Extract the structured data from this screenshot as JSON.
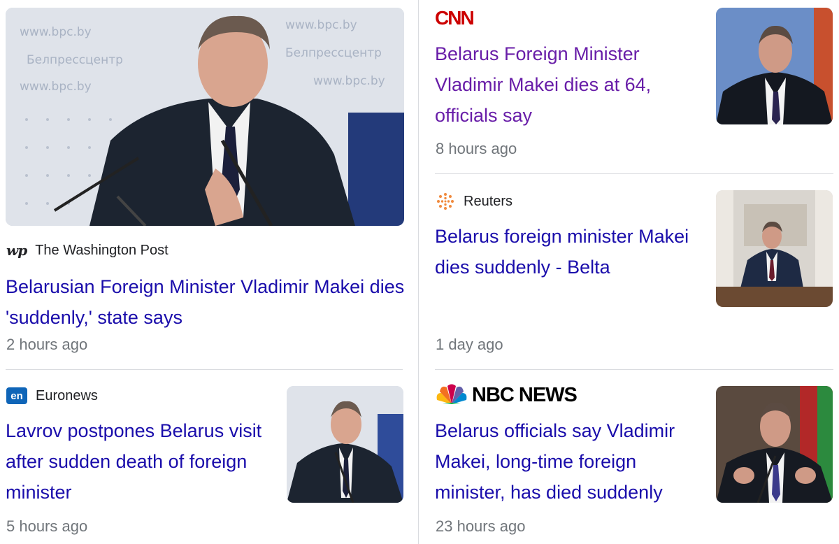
{
  "articles": [
    {
      "source": "The Washington Post",
      "source_logo": "wp",
      "headline": "Belarusian Foreign Minister Vladimir Makei dies 'suddenly,' state says",
      "time": "2 hours ago"
    },
    {
      "source": "CNN",
      "source_logo": "CNN",
      "headline": "Belarus Foreign Minister Vladimir Makei dies at 64, officials say",
      "time": "8 hours ago"
    },
    {
      "source": "Reuters",
      "source_logo": "reuters-icon",
      "headline": "Belarus foreign minister Makei dies suddenly - Belta",
      "time": "1 day ago"
    },
    {
      "source": "Euronews",
      "source_logo": "en",
      "headline": "Lavrov postpones Belarus visit after sudden death of foreign minister",
      "time": "5 hours ago"
    },
    {
      "source": "NBC NEWS",
      "source_logo": "nbc-peacock-icon",
      "headline": "Belarus officials say Vladimir Makei, long-time foreign minister, has died suddenly",
      "time": "23 hours ago"
    }
  ],
  "backdrop_text": {
    "url": "www.bpc.by",
    "name": "Белпрессцентр"
  },
  "colors": {
    "link": "#1a0dab",
    "visited": "#681da8",
    "meta": "#70757a",
    "divider": "#dadce0",
    "cnn_red": "#cc0000",
    "euronews_blue": "#0f65b8"
  }
}
